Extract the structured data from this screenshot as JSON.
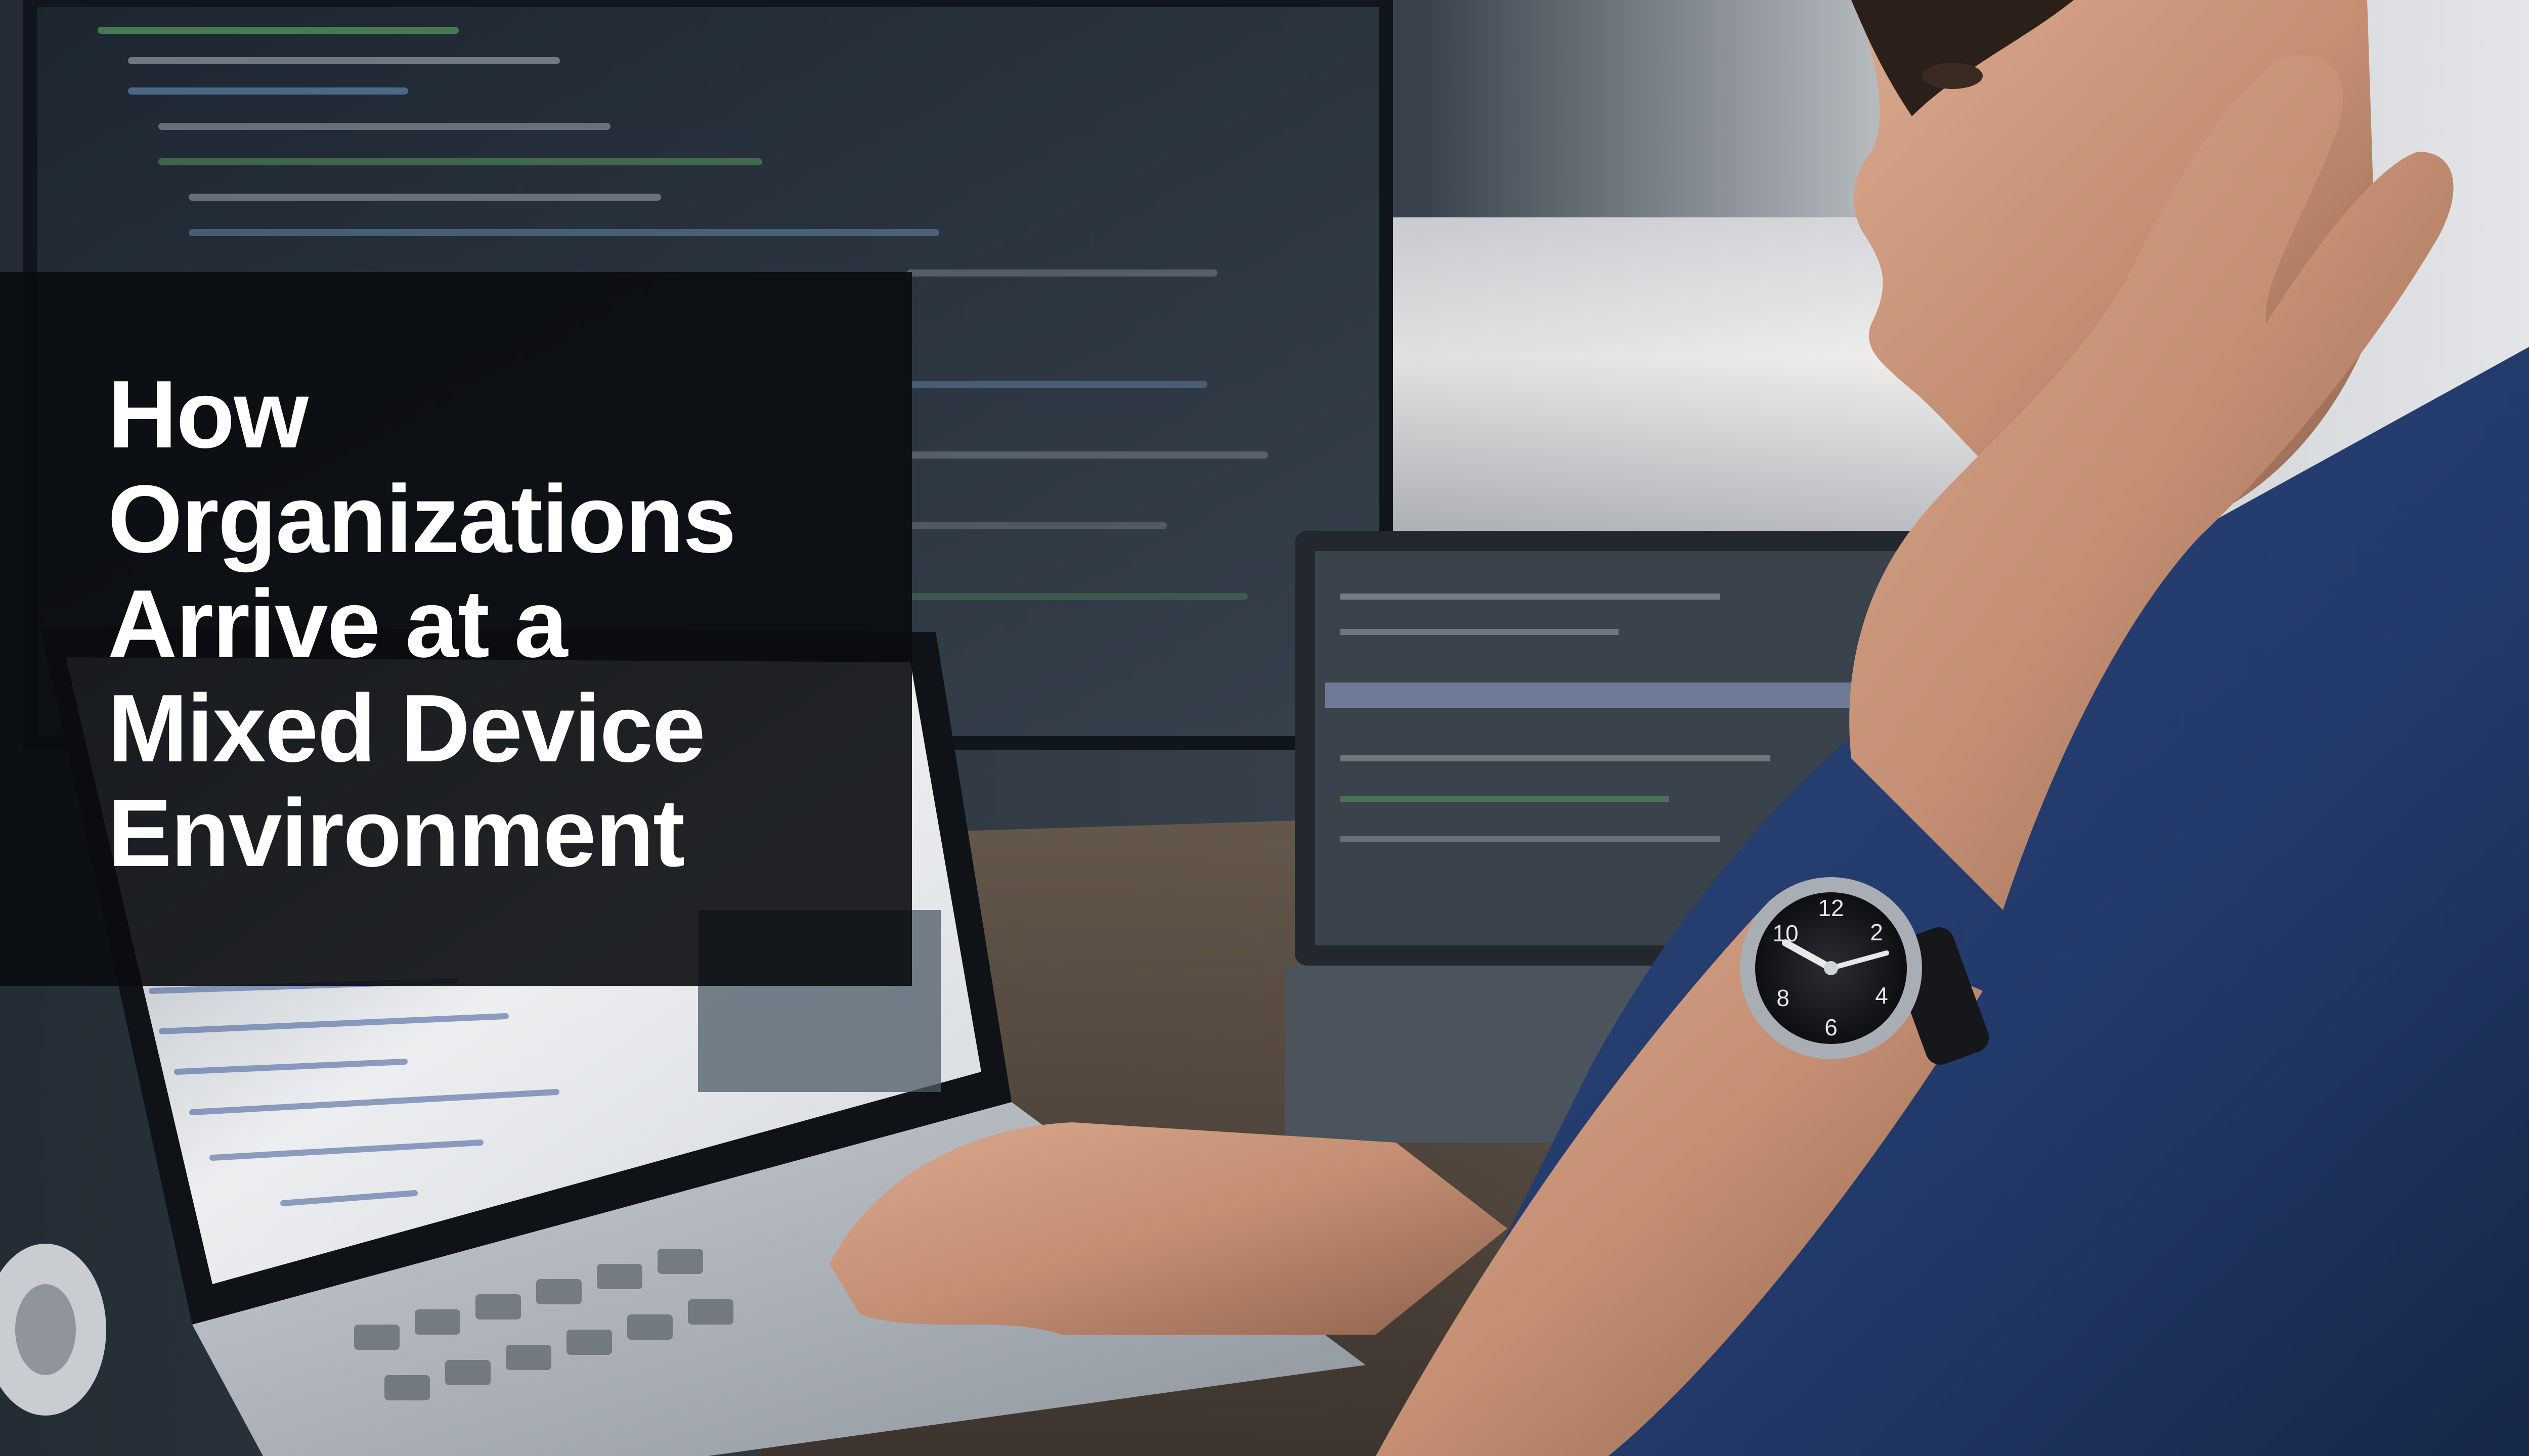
{
  "headline": {
    "lines": [
      "How",
      "Organizations",
      "Arrive at a",
      "Mixed Device",
      "Environment"
    ]
  },
  "photo": {
    "description": "Developer with hand on chin looking at multiple screens of code, laptop in foreground, wristwatch on left wrist",
    "colors": {
      "background": "#1c232b",
      "window_light": "#eef0f2",
      "shirt": "#27406e",
      "skin": "#c8957a",
      "panel": "#0a0c10",
      "headline_text": "#ffffff"
    }
  },
  "watch": {
    "numerals": [
      "12",
      "2",
      "4",
      "6",
      "8",
      "10"
    ]
  }
}
